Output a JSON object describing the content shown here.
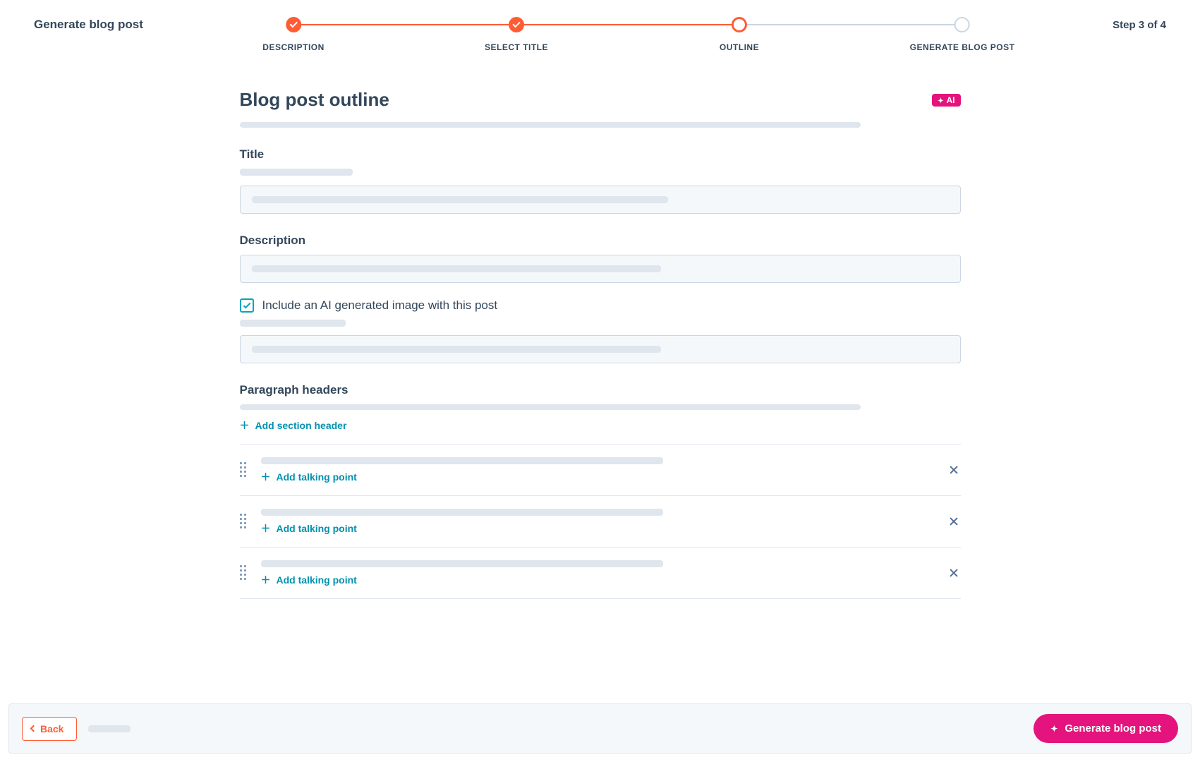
{
  "header": {
    "left_title": "Generate blog post",
    "step_indicator": "Step 3 of 4",
    "steps": [
      {
        "label": "DESCRIPTION",
        "state": "done"
      },
      {
        "label": "SELECT TITLE",
        "state": "done"
      },
      {
        "label": "OUTLINE",
        "state": "active"
      },
      {
        "label": "GENERATE BLOG POST",
        "state": "future"
      }
    ],
    "active_line_pct": 66.7
  },
  "page": {
    "heading": "Blog post outline",
    "ai_badge": "AI"
  },
  "title_section": {
    "label": "Title"
  },
  "description_section": {
    "label": "Description"
  },
  "checkbox": {
    "checked": true,
    "label": "Include an AI generated image with this post"
  },
  "paragraph_section": {
    "label": "Paragraph headers",
    "add_section_header": "Add section header",
    "add_talking_point": "Add talking point",
    "headers": [
      {
        "id": 1
      },
      {
        "id": 2
      },
      {
        "id": 3
      }
    ]
  },
  "footer": {
    "back": "Back",
    "generate": "Generate blog post"
  }
}
